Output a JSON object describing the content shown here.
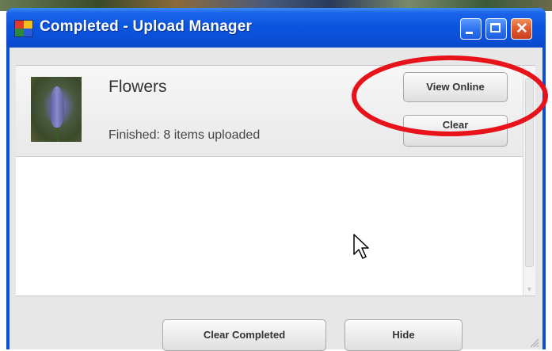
{
  "window": {
    "title": "Completed - Upload Manager",
    "app_icon": "picasa-icon",
    "controls": [
      "minimize-icon",
      "maximize-icon",
      "close-icon"
    ],
    "close_glyph": "✕"
  },
  "uploads": [
    {
      "thumbnail": "flower-thumbnail",
      "name": "Flowers",
      "status": "Finished: 8 items uploaded",
      "view_button": "View Online",
      "clear_button": "Clear"
    }
  ],
  "scrollbar": {
    "up_arrow": "▲",
    "down_arrow": "▼"
  },
  "footer": {
    "clear_completed_label": "Clear Completed",
    "hide_label": "Hide"
  },
  "annotation": {
    "type": "red-ellipse-highlight",
    "color": "#e8121b",
    "target": "View Online"
  },
  "colors": {
    "title_bar": "#0a4fd6",
    "close_button": "#e0582c",
    "client_background": "#e7e7e7"
  }
}
